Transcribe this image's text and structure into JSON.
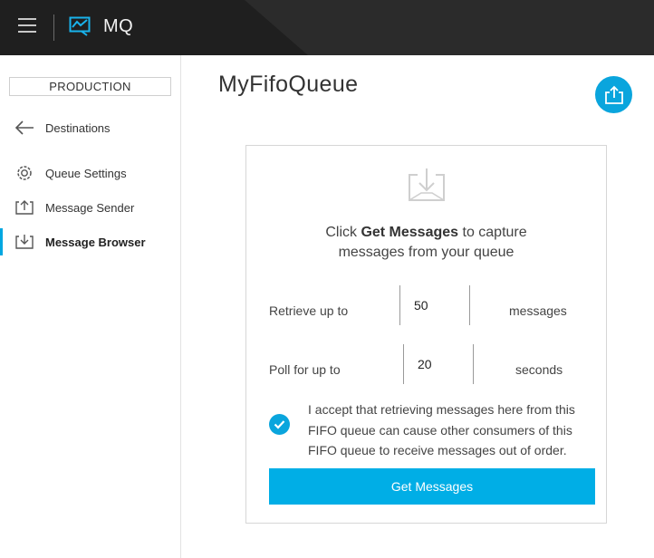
{
  "app": {
    "brand": "MQ"
  },
  "sidebar": {
    "environment": "PRODUCTION",
    "items": [
      {
        "label": "Destinations",
        "icon": "arrow-left-icon"
      },
      {
        "label": "Queue Settings",
        "icon": "gear-icon"
      },
      {
        "label": "Message Sender",
        "icon": "upload-tray-icon"
      },
      {
        "label": "Message Browser",
        "icon": "download-tray-icon",
        "active": true
      }
    ]
  },
  "main": {
    "title": "MyFifoQueue",
    "panel": {
      "lead_prefix": "Click ",
      "lead_bold": "Get Messages",
      "lead_suffix": " to capture",
      "lead_line2": "messages from your queue",
      "retrieve_label": "Retrieve up to",
      "retrieve_value": "50",
      "retrieve_unit": "messages",
      "poll_label": "Poll for up to",
      "poll_value": "20",
      "poll_unit": "seconds",
      "accept_text": "I accept that retrieving messages here from this FIFO queue can cause other consumers of this FIFO queue to receive messages out of order.",
      "accept_checked": true,
      "button_label": "Get Messages"
    }
  },
  "colors": {
    "accent": "#00aee6",
    "topbar": "#2b2b2b",
    "active_bar": "#00a7e1"
  }
}
